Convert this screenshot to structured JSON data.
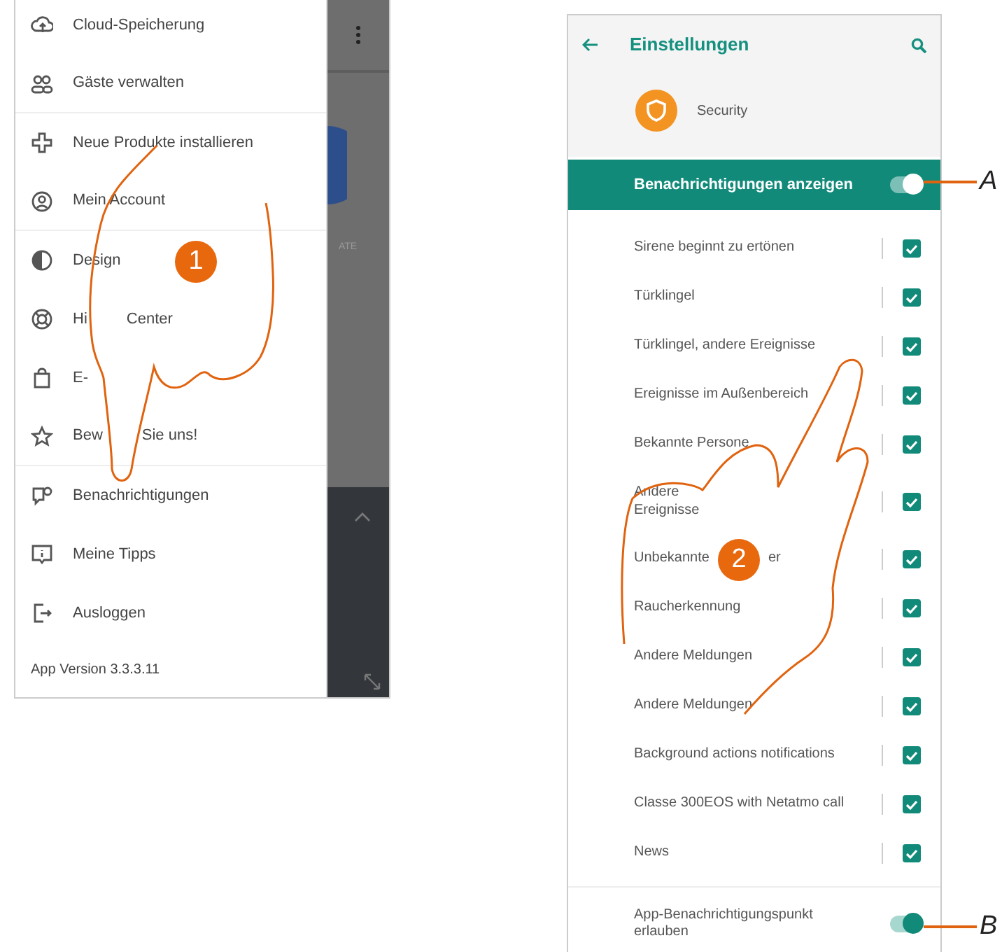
{
  "menu_screen": {
    "items": [
      {
        "label": "Cloud-Speicherung",
        "divider_after": false
      },
      {
        "label": "Gäste verwalten",
        "divider_after": true
      },
      {
        "label": "Neue Produkte installieren",
        "divider_after": false
      },
      {
        "label": "Mein Account",
        "divider_after": true
      },
      {
        "label": "Design",
        "divider_after": false
      },
      {
        "label": "Hi",
        "label_tail": "Center",
        "divider_after": false
      },
      {
        "label": "E-",
        "divider_after": false
      },
      {
        "label": "Bew",
        "label_tail": "Sie uns!",
        "divider_after": true
      },
      {
        "label": "Benachrichtigungen",
        "divider_after": false
      },
      {
        "label": "Meine Tipps",
        "divider_after": false
      },
      {
        "label": "Ausloggen",
        "divider_after": false
      }
    ],
    "version": "App Version 3.3.3.11",
    "background_label": "ATE",
    "step": "1"
  },
  "settings_screen": {
    "title": "Einstellungen",
    "device": "Security",
    "master_toggle": {
      "label": "Benachrichtigungen anzeigen",
      "on": true,
      "callout": "A"
    },
    "rows": [
      {
        "label": "Sirene beginnt zu ertönen",
        "checked": true
      },
      {
        "label": "Türklingel",
        "checked": true
      },
      {
        "label": "Türklingel, andere Ereignisse",
        "checked": true
      },
      {
        "label": "Ereignisse im Außenbereich",
        "checked": true
      },
      {
        "label": "Bekannte Persone",
        "checked": true
      },
      {
        "label": "Andere",
        "label_tail": "Ereignisse",
        "wrapped": true,
        "checked": true
      },
      {
        "label": "Unbekannte",
        "label_tail": "er",
        "checked": true
      },
      {
        "label": "Raucherkennung",
        "checked": true
      },
      {
        "label": "Andere Meldungen",
        "checked": true
      },
      {
        "label": "Andere Meldungen",
        "checked": true
      },
      {
        "label": "Background actions notifications",
        "checked": true
      },
      {
        "label": "Classe 300EOS with Netatmo call",
        "checked": true
      },
      {
        "label": "News",
        "checked": true
      }
    ],
    "badge_toggle": {
      "label": "App-Benachrichtigungspunkt erlauben",
      "on": true,
      "callout": "B"
    },
    "step": "2"
  }
}
